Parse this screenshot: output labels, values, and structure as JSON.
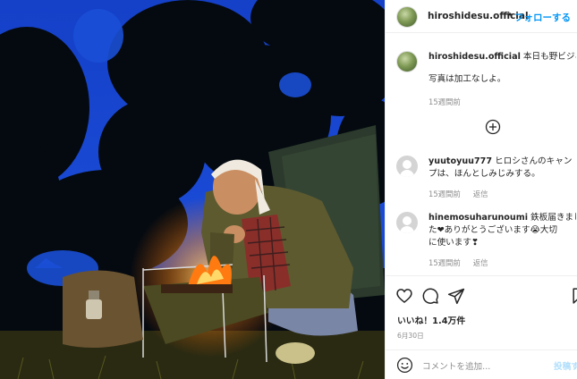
{
  "post": {
    "username": "hiroshidesu.official",
    "separator": "•",
    "follow_label": "フォローする",
    "photo_alt": "焚き火の前でくつろぐ男性"
  },
  "caption": {
    "username": "hiroshidesu.official",
    "line1": "本日も野ビジネス",
    "line2": "写真は加工なしよ。",
    "time": "15週間前"
  },
  "load_more_icon": "plus-circle-icon",
  "comments": [
    {
      "username": "yuutoyuu777",
      "line1": "ヒロシさんのキャン",
      "line2": "プは、ほんとしみじみする。",
      "time": "15週間前",
      "reply": "返信"
    },
    {
      "username": "hinemosuharunoumi",
      "line1": "鉄板届きまし",
      "line2": "た❤ありがとうございます😭大切",
      "line3": "に使います❣",
      "time": "15週間前",
      "reply": "返信"
    }
  ],
  "actions": {
    "icons": [
      "heart-icon",
      "comment-icon",
      "share-icon",
      "bookmark-icon"
    ],
    "likes": "いいね！1.4万件",
    "date": "6月30日"
  },
  "composer": {
    "emoji_icon": "emoji-icon",
    "placeholder": "コメントを追加...",
    "post_label": "投稿す"
  },
  "colors": {
    "link_blue": "#0095f6",
    "meta_gray": "#8e8e8e",
    "text": "#262626",
    "sky": "#1a4fd6",
    "fire": "#ff8a1a"
  }
}
